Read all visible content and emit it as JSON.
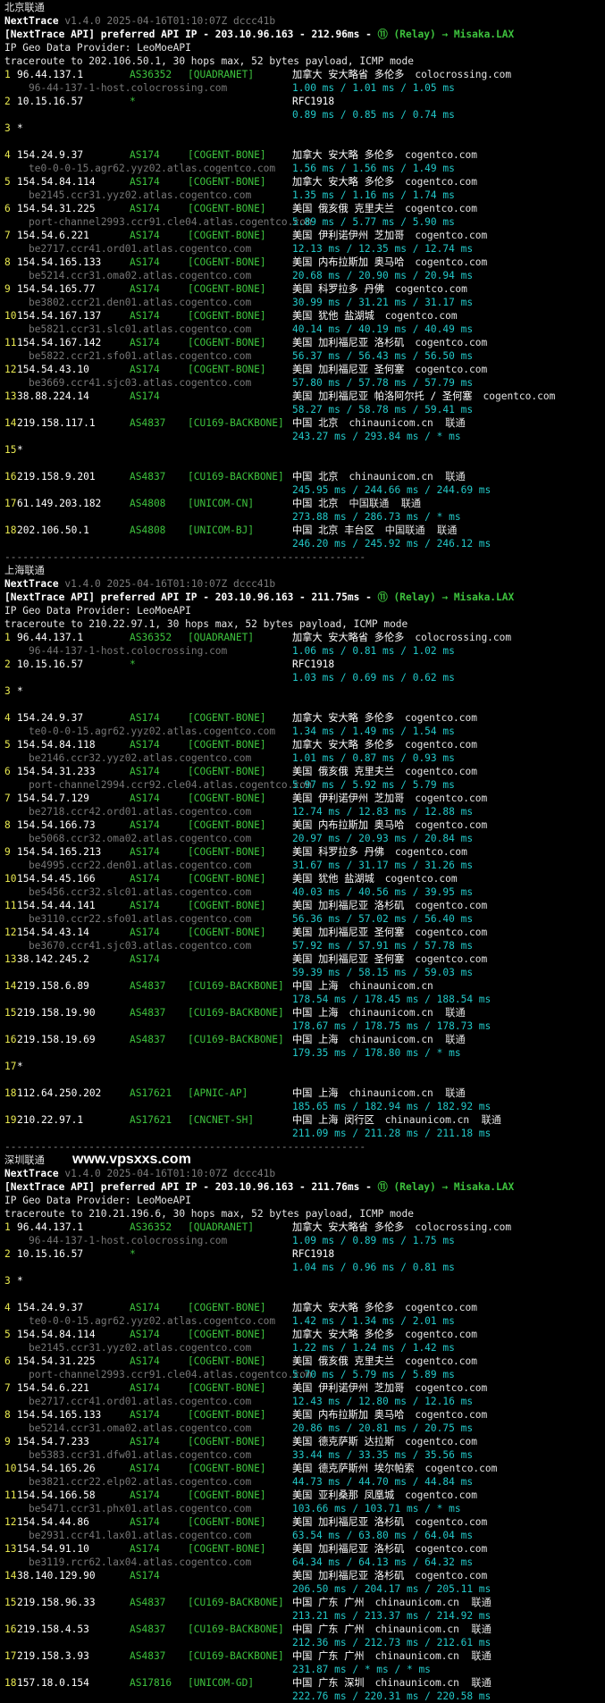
{
  "sections": [
    {
      "title": "北京联通",
      "watermark": "",
      "tool_name": "NextTrace",
      "tool_meta": "v1.4.0 2025-04-16T01:10:07Z dccc41b",
      "api_text": "[NextTrace API] preferred API IP - 203.10.96.163 - 212.96ms - ",
      "relay_text": "⑪ (Relay) → Misaka.LAX",
      "geo_provider": "IP Geo Data Provider: LeoMoeAPI",
      "traceroute": "traceroute to 202.106.50.1, 30 hops max, 52 bytes payload, ICMP mode",
      "hops": [
        {
          "n": "1",
          "ip": "96.44.137.1",
          "asn": "AS36352",
          "tag": "[QUADRANET]",
          "geo": "加拿大 安大略省 多伦多",
          "host": "colocrossing.com",
          "rdns": "96-44-137-1-host.colocrossing.com",
          "rtt": "1.00 ms / 1.01 ms / 1.05 ms"
        },
        {
          "n": "2",
          "ip": "10.15.16.57",
          "asn": "*",
          "tag": "",
          "geo": "RFC1918",
          "host": "",
          "rdns": "",
          "rtt": "0.89 ms / 0.85 ms / 0.74 ms"
        },
        {
          "n": "3",
          "ip": "*",
          "asn": "",
          "tag": "",
          "geo": "",
          "host": "",
          "rdns": "",
          "rtt": ""
        },
        {
          "n": "4",
          "ip": "154.24.9.37",
          "asn": "AS174",
          "tag": "[COGENT-BONE]",
          "geo": "加拿大 安大略 多伦多",
          "host": "cogentco.com",
          "rdns": "te0-0-0-15.agr62.yyz02.atlas.cogentco.com",
          "rtt": "1.56 ms / 1.56 ms / 1.49 ms"
        },
        {
          "n": "5",
          "ip": "154.54.84.114",
          "asn": "AS174",
          "tag": "[COGENT-BONE]",
          "geo": "加拿大 安大略 多伦多",
          "host": "cogentco.com",
          "rdns": "be2145.ccr31.yyz02.atlas.cogentco.com",
          "rtt": "1.35 ms / 1.16 ms / 1.74 ms"
        },
        {
          "n": "6",
          "ip": "154.54.31.225",
          "asn": "AS174",
          "tag": "[COGENT-BONE]",
          "geo": "美国 俄亥俄 克里夫兰",
          "host": "cogentco.com",
          "rdns": "port-channel2993.ccr91.cle04.atlas.cogentco.com",
          "rtt": "5.89 ms / 5.77 ms / 5.90 ms"
        },
        {
          "n": "7",
          "ip": "154.54.6.221",
          "asn": "AS174",
          "tag": "[COGENT-BONE]",
          "geo": "美国 伊利诺伊州 芝加哥",
          "host": "cogentco.com",
          "rdns": "be2717.ccr41.ord01.atlas.cogentco.com",
          "rtt": "12.13 ms / 12.35 ms / 12.74 ms"
        },
        {
          "n": "8",
          "ip": "154.54.165.133",
          "asn": "AS174",
          "tag": "[COGENT-BONE]",
          "geo": "美国 内布拉斯加 奥马哈",
          "host": "cogentco.com",
          "rdns": "be5214.ccr31.oma02.atlas.cogentco.com",
          "rtt": "20.68 ms / 20.90 ms / 20.94 ms"
        },
        {
          "n": "9",
          "ip": "154.54.165.77",
          "asn": "AS174",
          "tag": "[COGENT-BONE]",
          "geo": "美国 科罗拉多 丹佛",
          "host": "cogentco.com",
          "rdns": "be3802.ccr21.den01.atlas.cogentco.com",
          "rtt": "30.99 ms / 31.21 ms / 31.17 ms"
        },
        {
          "n": "10",
          "ip": "154.54.167.137",
          "asn": "AS174",
          "tag": "[COGENT-BONE]",
          "geo": "美国 犹他 盐湖城",
          "host": "cogentco.com",
          "rdns": "be5821.ccr31.slc01.atlas.cogentco.com",
          "rtt": "40.14 ms / 40.19 ms / 40.49 ms"
        },
        {
          "n": "11",
          "ip": "154.54.167.142",
          "asn": "AS174",
          "tag": "[COGENT-BONE]",
          "geo": "美国 加利福尼亚 洛杉矶",
          "host": "cogentco.com",
          "rdns": "be5822.ccr21.sfo01.atlas.cogentco.com",
          "rtt": "56.37 ms / 56.43 ms / 56.50 ms"
        },
        {
          "n": "12",
          "ip": "154.54.43.10",
          "asn": "AS174",
          "tag": "[COGENT-BONE]",
          "geo": "美国 加利福尼亚 圣何塞",
          "host": "cogentco.com",
          "rdns": "be3669.ccr41.sjc03.atlas.cogentco.com",
          "rtt": "57.80 ms / 57.78 ms / 57.79 ms"
        },
        {
          "n": "13",
          "ip": "38.88.224.14",
          "asn": "AS174",
          "tag": "",
          "geo": "美国 加利福尼亚 帕洛阿尔托 / 圣何塞",
          "host": "cogentco.com",
          "rdns": "",
          "rtt": "58.27 ms / 58.78 ms / 59.41 ms"
        },
        {
          "n": "14",
          "ip": "219.158.117.1",
          "asn": "AS4837",
          "tag": "[CU169-BACKBONE]",
          "geo": "中国 北京",
          "host": "chinaunicom.cn  联通",
          "rdns": "",
          "rtt": "243.27 ms / 293.84 ms / * ms"
        },
        {
          "n": "15",
          "ip": "*",
          "asn": "",
          "tag": "",
          "geo": "",
          "host": "",
          "rdns": "",
          "rtt": ""
        },
        {
          "n": "16",
          "ip": "219.158.9.201",
          "asn": "AS4837",
          "tag": "[CU169-BACKBONE]",
          "geo": "中国 北京",
          "host": "chinaunicom.cn  联通",
          "rdns": "",
          "rtt": "245.95 ms / 244.66 ms / 244.69 ms"
        },
        {
          "n": "17",
          "ip": "61.149.203.182",
          "asn": "AS4808",
          "tag": "[UNICOM-CN]",
          "geo": "中国 北京",
          "host": "中国联通  联通",
          "rdns": "",
          "rtt": "273.88 ms / 286.73 ms / * ms"
        },
        {
          "n": "18",
          "ip": "202.106.50.1",
          "asn": "AS4808",
          "tag": "[UNICOM-BJ]",
          "geo": "中国 北京 丰台区",
          "host": "中国联通  联通",
          "rdns": "",
          "rtt": "246.20 ms / 245.92 ms / 246.12 ms"
        }
      ]
    },
    {
      "title": "上海联通",
      "watermark": "",
      "tool_name": "NextTrace",
      "tool_meta": "v1.4.0 2025-04-16T01:10:07Z dccc41b",
      "api_text": "[NextTrace API] preferred API IP - 203.10.96.163 - 211.75ms - ",
      "relay_text": "⑪ (Relay) → Misaka.LAX",
      "geo_provider": "IP Geo Data Provider: LeoMoeAPI",
      "traceroute": "traceroute to 210.22.97.1, 30 hops max, 52 bytes payload, ICMP mode",
      "hops": [
        {
          "n": "1",
          "ip": "96.44.137.1",
          "asn": "AS36352",
          "tag": "[QUADRANET]",
          "geo": "加拿大 安大略省 多伦多",
          "host": "colocrossing.com",
          "rdns": "96-44-137-1-host.colocrossing.com",
          "rtt": "1.06 ms / 0.81 ms / 1.02 ms"
        },
        {
          "n": "2",
          "ip": "10.15.16.57",
          "asn": "*",
          "tag": "",
          "geo": "RFC1918",
          "host": "",
          "rdns": "",
          "rtt": "1.03 ms / 0.69 ms / 0.62 ms"
        },
        {
          "n": "3",
          "ip": "*",
          "asn": "",
          "tag": "",
          "geo": "",
          "host": "",
          "rdns": "",
          "rtt": ""
        },
        {
          "n": "4",
          "ip": "154.24.9.37",
          "asn": "AS174",
          "tag": "[COGENT-BONE]",
          "geo": "加拿大 安大略 多伦多",
          "host": "cogentco.com",
          "rdns": "te0-0-0-15.agr62.yyz02.atlas.cogentco.com",
          "rtt": "1.34 ms / 1.49 ms / 1.54 ms"
        },
        {
          "n": "5",
          "ip": "154.54.84.118",
          "asn": "AS174",
          "tag": "[COGENT-BONE]",
          "geo": "加拿大 安大略 多伦多",
          "host": "cogentco.com",
          "rdns": "be2146.ccr32.yyz02.atlas.cogentco.com",
          "rtt": "1.01 ms / 0.87 ms / 0.93 ms"
        },
        {
          "n": "6",
          "ip": "154.54.31.233",
          "asn": "AS174",
          "tag": "[COGENT-BONE]",
          "geo": "美国 俄亥俄 克里夫兰",
          "host": "cogentco.com",
          "rdns": "port-channel2994.ccr92.cle04.atlas.cogentco.com",
          "rtt": "5.97 ms / 5.92 ms / 5.79 ms"
        },
        {
          "n": "7",
          "ip": "154.54.7.129",
          "asn": "AS174",
          "tag": "[COGENT-BONE]",
          "geo": "美国 伊利诺伊州 芝加哥",
          "host": "cogentco.com",
          "rdns": "be2718.ccr42.ord01.atlas.cogentco.com",
          "rtt": "12.74 ms / 12.83 ms / 12.88 ms"
        },
        {
          "n": "8",
          "ip": "154.54.166.73",
          "asn": "AS174",
          "tag": "[COGENT-BONE]",
          "geo": "美国 内布拉斯加 奥马哈",
          "host": "cogentco.com",
          "rdns": "be5068.ccr32.oma02.atlas.cogentco.com",
          "rtt": "20.97 ms / 20.93 ms / 20.84 ms"
        },
        {
          "n": "9",
          "ip": "154.54.165.213",
          "asn": "AS174",
          "tag": "[COGENT-BONE]",
          "geo": "美国 科罗拉多 丹佛",
          "host": "cogentco.com",
          "rdns": "be4995.ccr22.den01.atlas.cogentco.com",
          "rtt": "31.67 ms / 31.17 ms / 31.26 ms"
        },
        {
          "n": "10",
          "ip": "154.54.45.166",
          "asn": "AS174",
          "tag": "[COGENT-BONE]",
          "geo": "美国 犹他 盐湖城",
          "host": "cogentco.com",
          "rdns": "be5456.ccr32.slc01.atlas.cogentco.com",
          "rtt": "40.03 ms / 40.56 ms / 39.95 ms"
        },
        {
          "n": "11",
          "ip": "154.54.44.141",
          "asn": "AS174",
          "tag": "[COGENT-BONE]",
          "geo": "美国 加利福尼亚 洛杉矶",
          "host": "cogentco.com",
          "rdns": "be3110.ccr22.sfo01.atlas.cogentco.com",
          "rtt": "56.36 ms / 57.02 ms / 56.40 ms"
        },
        {
          "n": "12",
          "ip": "154.54.43.14",
          "asn": "AS174",
          "tag": "[COGENT-BONE]",
          "geo": "美国 加利福尼亚 圣何塞",
          "host": "cogentco.com",
          "rdns": "be3670.ccr41.sjc03.atlas.cogentco.com",
          "rtt": "57.92 ms / 57.91 ms / 57.78 ms"
        },
        {
          "n": "13",
          "ip": "38.142.245.2",
          "asn": "AS174",
          "tag": "",
          "geo": "美国 加利福尼亚 圣何塞",
          "host": "cogentco.com",
          "rdns": "",
          "rtt": "59.39 ms / 58.15 ms / 59.03 ms"
        },
        {
          "n": "14",
          "ip": "219.158.6.89",
          "asn": "AS4837",
          "tag": "[CU169-BACKBONE]",
          "geo": "中国 上海",
          "host": "chinaunicom.cn",
          "rdns": "",
          "rtt": "178.54 ms / 178.45 ms / 188.54 ms"
        },
        {
          "n": "15",
          "ip": "219.158.19.90",
          "asn": "AS4837",
          "tag": "[CU169-BACKBONE]",
          "geo": "中国 上海",
          "host": "chinaunicom.cn  联通",
          "rdns": "",
          "rtt": "178.67 ms / 178.75 ms / 178.73 ms"
        },
        {
          "n": "16",
          "ip": "219.158.19.69",
          "asn": "AS4837",
          "tag": "[CU169-BACKBONE]",
          "geo": "中国 上海",
          "host": "chinaunicom.cn  联通",
          "rdns": "",
          "rtt": "179.35 ms / 178.80 ms / * ms"
        },
        {
          "n": "17",
          "ip": "*",
          "asn": "",
          "tag": "",
          "geo": "",
          "host": "",
          "rdns": "",
          "rtt": ""
        },
        {
          "n": "18",
          "ip": "112.64.250.202",
          "asn": "AS17621",
          "tag": "[APNIC-AP]",
          "geo": "中国 上海",
          "host": "chinaunicom.cn  联通",
          "rdns": "",
          "rtt": "185.65 ms / 182.94 ms / 182.92 ms"
        },
        {
          "n": "19",
          "ip": "210.22.97.1",
          "asn": "AS17621",
          "tag": "[CNCNET-SH]",
          "geo": "中国 上海 闵行区",
          "host": "chinaunicom.cn  联通",
          "rdns": "",
          "rtt": "211.09 ms / 211.28 ms / 211.18 ms"
        }
      ]
    },
    {
      "title": "深圳联通",
      "watermark": "www.vpsxxs.com",
      "tool_name": "NextTrace",
      "tool_meta": "v1.4.0 2025-04-16T01:10:07Z dccc41b",
      "api_text": "[NextTrace API] preferred API IP - 203.10.96.163 - 211.76ms - ",
      "relay_text": "⑪ (Relay) → Misaka.LAX",
      "geo_provider": "IP Geo Data Provider: LeoMoeAPI",
      "traceroute": "traceroute to 210.21.196.6, 30 hops max, 52 bytes payload, ICMP mode",
      "hops": [
        {
          "n": "1",
          "ip": "96.44.137.1",
          "asn": "AS36352",
          "tag": "[QUADRANET]",
          "geo": "加拿大 安大略省 多伦多",
          "host": "colocrossing.com",
          "rdns": "96-44-137-1-host.colocrossing.com",
          "rtt": "1.09 ms / 0.89 ms / 1.75 ms"
        },
        {
          "n": "2",
          "ip": "10.15.16.57",
          "asn": "*",
          "tag": "",
          "geo": "RFC1918",
          "host": "",
          "rdns": "",
          "rtt": "1.04 ms / 0.96 ms / 0.81 ms"
        },
        {
          "n": "3",
          "ip": "*",
          "asn": "",
          "tag": "",
          "geo": "",
          "host": "",
          "rdns": "",
          "rtt": ""
        },
        {
          "n": "4",
          "ip": "154.24.9.37",
          "asn": "AS174",
          "tag": "[COGENT-BONE]",
          "geo": "加拿大 安大略 多伦多",
          "host": "cogentco.com",
          "rdns": "te0-0-0-15.agr62.yyz02.atlas.cogentco.com",
          "rtt": "1.42 ms / 1.34 ms / 2.01 ms"
        },
        {
          "n": "5",
          "ip": "154.54.84.114",
          "asn": "AS174",
          "tag": "[COGENT-BONE]",
          "geo": "加拿大 安大略 多伦多",
          "host": "cogentco.com",
          "rdns": "be2145.ccr31.yyz02.atlas.cogentco.com",
          "rtt": "1.22 ms / 1.24 ms / 1.42 ms"
        },
        {
          "n": "6",
          "ip": "154.54.31.225",
          "asn": "AS174",
          "tag": "[COGENT-BONE]",
          "geo": "美国 俄亥俄 克里夫兰",
          "host": "cogentco.com",
          "rdns": "port-channel2993.ccr91.cle04.atlas.cogentco.com",
          "rtt": "5.70 ms / 5.79 ms / 5.89 ms"
        },
        {
          "n": "7",
          "ip": "154.54.6.221",
          "asn": "AS174",
          "tag": "[COGENT-BONE]",
          "geo": "美国 伊利诺伊州 芝加哥",
          "host": "cogentco.com",
          "rdns": "be2717.ccr41.ord01.atlas.cogentco.com",
          "rtt": "12.43 ms / 12.80 ms / 12.16 ms"
        },
        {
          "n": "8",
          "ip": "154.54.165.133",
          "asn": "AS174",
          "tag": "[COGENT-BONE]",
          "geo": "美国 内布拉斯加 奥马哈",
          "host": "cogentco.com",
          "rdns": "be5214.ccr31.oma02.atlas.cogentco.com",
          "rtt": "20.86 ms / 20.81 ms / 20.75 ms"
        },
        {
          "n": "9",
          "ip": "154.54.7.233",
          "asn": "AS174",
          "tag": "[COGENT-BONE]",
          "geo": "美国 德克萨斯 达拉斯",
          "host": "cogentco.com",
          "rdns": "be5383.ccr31.dfw01.atlas.cogentco.com",
          "rtt": "33.44 ms / 33.35 ms / 35.56 ms"
        },
        {
          "n": "10",
          "ip": "154.54.165.26",
          "asn": "AS174",
          "tag": "[COGENT-BONE]",
          "geo": "美国 德克萨斯州 埃尔帕索",
          "host": "cogentco.com",
          "rdns": "be3821.ccr22.elp02.atlas.cogentco.com",
          "rtt": "44.73 ms / 44.70 ms / 44.84 ms"
        },
        {
          "n": "11",
          "ip": "154.54.166.58",
          "asn": "AS174",
          "tag": "[COGENT-BONE]",
          "geo": "美国 亚利桑那 凤凰城",
          "host": "cogentco.com",
          "rdns": "be5471.ccr31.phx01.atlas.cogentco.com",
          "rtt": "103.66 ms / 103.71 ms / * ms"
        },
        {
          "n": "12",
          "ip": "154.54.44.86",
          "asn": "AS174",
          "tag": "[COGENT-BONE]",
          "geo": "美国 加利福尼亚 洛杉矶",
          "host": "cogentco.com",
          "rdns": "be2931.ccr41.lax01.atlas.cogentco.com",
          "rtt": "63.54 ms / 63.80 ms / 64.04 ms"
        },
        {
          "n": "13",
          "ip": "154.54.91.10",
          "asn": "AS174",
          "tag": "[COGENT-BONE]",
          "geo": "美国 加利福尼亚 洛杉矶",
          "host": "cogentco.com",
          "rdns": "be3119.rcr62.lax04.atlas.cogentco.com",
          "rtt": "64.34 ms / 64.13 ms / 64.32 ms"
        },
        {
          "n": "14",
          "ip": "38.140.129.90",
          "asn": "AS174",
          "tag": "",
          "geo": "美国 加利福尼亚 洛杉矶",
          "host": "cogentco.com",
          "rdns": "",
          "rtt": "206.50 ms / 204.17 ms / 205.11 ms"
        },
        {
          "n": "15",
          "ip": "219.158.96.33",
          "asn": "AS4837",
          "tag": "[CU169-BACKBONE]",
          "geo": "中国 广东 广州",
          "host": "chinaunicom.cn  联通",
          "rdns": "",
          "rtt": "213.21 ms / 213.37 ms / 214.92 ms"
        },
        {
          "n": "16",
          "ip": "219.158.4.53",
          "asn": "AS4837",
          "tag": "[CU169-BACKBONE]",
          "geo": "中国 广东 广州",
          "host": "chinaunicom.cn  联通",
          "rdns": "",
          "rtt": "212.36 ms / 212.73 ms / 212.61 ms"
        },
        {
          "n": "17",
          "ip": "219.158.3.93",
          "asn": "AS4837",
          "tag": "[CU169-BACKBONE]",
          "geo": "中国 广东 广州",
          "host": "chinaunicom.cn  联通",
          "rdns": "",
          "rtt": "231.87 ms / * ms / * ms"
        },
        {
          "n": "18",
          "ip": "157.18.0.154",
          "asn": "AS17816",
          "tag": "[UNICOM-GD]",
          "geo": "中国 广东 深圳",
          "host": "chinaunicom.cn  联通",
          "rdns": "",
          "rtt": "222.76 ms / 220.31 ms / 220.58 ms"
        }
      ]
    }
  ],
  "separator": "------------------------------------------------------------",
  "colors": {
    "background": "#000000",
    "hop_number": "#e8e850",
    "asn": "#3ec43e",
    "rtt": "#22c8c8",
    "rdns": "#777777"
  }
}
